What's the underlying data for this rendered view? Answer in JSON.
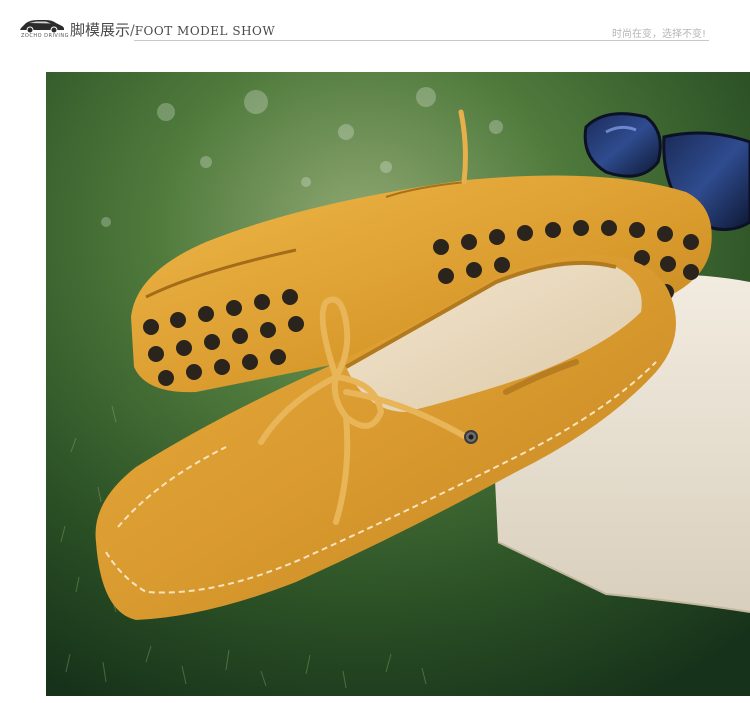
{
  "header": {
    "logo_text": "ZOCHO DRIVING",
    "title_cn": "脚模展示",
    "title_sep": "/",
    "title_en": "FOOT MODEL SHOW",
    "tagline": "时尚在变，选择不变!"
  },
  "photo": {
    "subject": "suede-loafers-on-grass",
    "colors": {
      "shoe": "#E0A73A",
      "grass": "#2E5A24",
      "cloth": "#E9E2D4",
      "pebble": "#2A241D"
    }
  }
}
